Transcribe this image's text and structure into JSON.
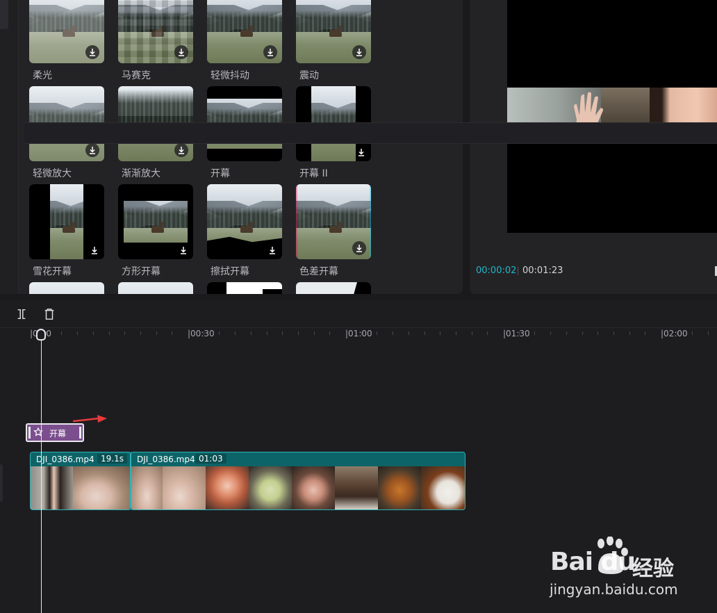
{
  "effects": {
    "tiles": [
      {
        "label": "柔光"
      },
      {
        "label": "马赛克"
      },
      {
        "label": "轻微抖动"
      },
      {
        "label": "震动"
      },
      {
        "label": "轻微放大"
      },
      {
        "label": "渐渐放大"
      },
      {
        "label": "开幕"
      },
      {
        "label": "开幕 II"
      },
      {
        "label": "雪花开幕"
      },
      {
        "label": "方形开幕"
      },
      {
        "label": "擦拭开幕"
      },
      {
        "label": "色差开幕"
      }
    ]
  },
  "preview": {
    "current_time": "00:00:02",
    "total_time": "00:01:23"
  },
  "timeline": {
    "ruler_labels": [
      "|0:00",
      "|00:30",
      "|01:00",
      "|01:30",
      "|02:00"
    ],
    "effect_clip": {
      "label": "开幕"
    },
    "clips": [
      {
        "name": "DJI_0386.mp4",
        "duration": "19.1s"
      },
      {
        "name": "DJI_0386.mp4",
        "duration": "01:03"
      }
    ]
  },
  "watermark": {
    "brand": "Bai du",
    "cn": "经验",
    "url": "jingyan.baidu.com"
  },
  "colors": {
    "accent_time": "#20b8c8",
    "effect_clip": "#7b4f8e",
    "video_clip": "#137479",
    "arrow": "#e8393b"
  }
}
